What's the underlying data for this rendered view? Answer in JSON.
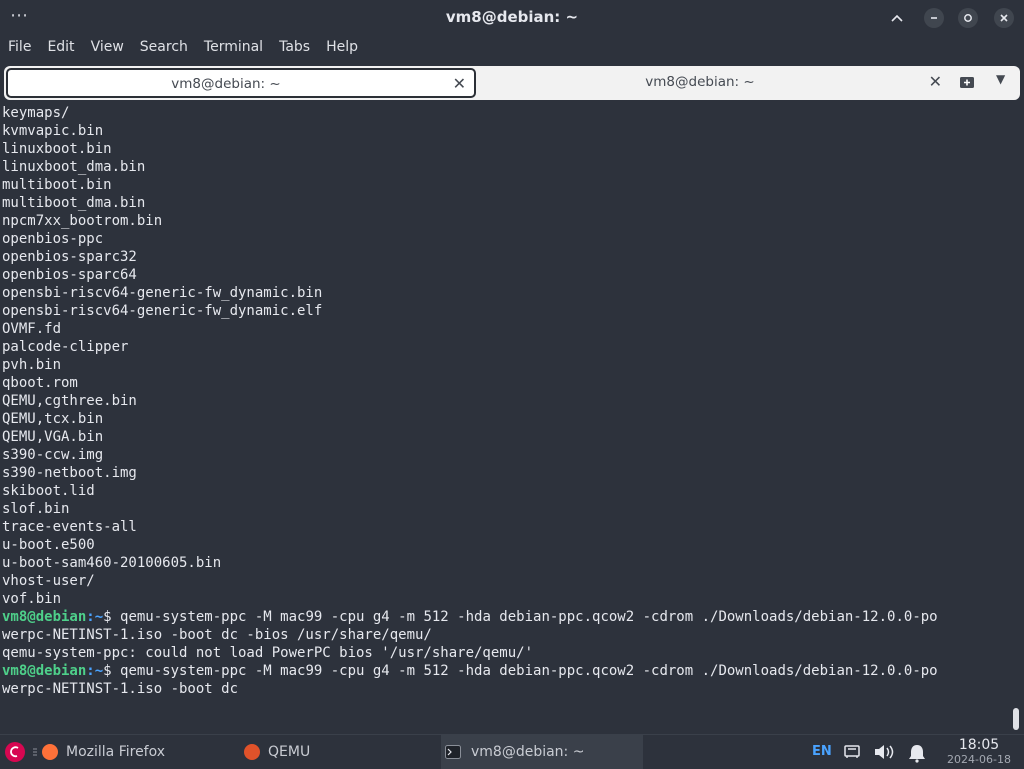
{
  "window": {
    "title": "vm8@debian: ~",
    "menu_dots": "⋯"
  },
  "menu": [
    "File",
    "Edit",
    "View",
    "Search",
    "Terminal",
    "Tabs",
    "Help"
  ],
  "tabs": [
    {
      "label": "vm8@debian: ~",
      "active": true,
      "close": "✕"
    },
    {
      "label": "vm8@debian: ~",
      "active": false,
      "close": "✕"
    }
  ],
  "tab_icons": {
    "new_tab": "new-tab-icon",
    "menu": "▼"
  },
  "terminal": {
    "lines": [
      "keymaps/",
      "kvmvapic.bin",
      "linuxboot.bin",
      "linuxboot_dma.bin",
      "multiboot.bin",
      "multiboot_dma.bin",
      "npcm7xx_bootrom.bin",
      "openbios-ppc",
      "openbios-sparc32",
      "openbios-sparc64",
      "opensbi-riscv64-generic-fw_dynamic.bin",
      "opensbi-riscv64-generic-fw_dynamic.elf",
      "OVMF.fd",
      "palcode-clipper",
      "pvh.bin",
      "qboot.rom",
      "QEMU,cgthree.bin",
      "QEMU,tcx.bin",
      "QEMU,VGA.bin",
      "s390-ccw.img",
      "s390-netboot.img",
      "skiboot.lid",
      "slof.bin",
      "trace-events-all",
      "u-boot.e500",
      "u-boot-sam460-20100605.bin",
      "vhost-user/",
      "vof.bin"
    ],
    "prompt_user": "vm8@debian",
    "prompt_path": ":~",
    "cmd1": "$ qemu-system-ppc -M mac99 -cpu g4 -m 512 -hda debian-ppc.qcow2 -cdrom ./Downloads/debian-12.0.0-po",
    "cmd1_wrap": "werpc-NETINST-1.iso -boot dc -bios /usr/share/qemu/",
    "error": "qemu-system-ppc: could not load PowerPC bios '/usr/share/qemu/'",
    "cmd2": "$ qemu-system-ppc -M mac99 -cpu g4 -m 512 -hda debian-ppc.qcow2 -cdrom ./Downloads/debian-12.0.0-po",
    "cmd2_wrap": "werpc-NETINST-1.iso -boot dc"
  },
  "taskbar": {
    "apps": [
      {
        "label": "Mozilla Firefox",
        "icon": "firefox-icon"
      },
      {
        "label": "QEMU",
        "icon": "qemu-icon"
      },
      {
        "label": "vm8@debian: ~",
        "icon": "terminal-icon",
        "active": true
      }
    ],
    "lang": "EN",
    "time": "18:05",
    "date": "2024-06-18"
  },
  "colors": {
    "background": "#2d323c",
    "prompt_user": "#4ed08a",
    "prompt_path": "#4aa3ff",
    "firefox": "#ff7139"
  }
}
